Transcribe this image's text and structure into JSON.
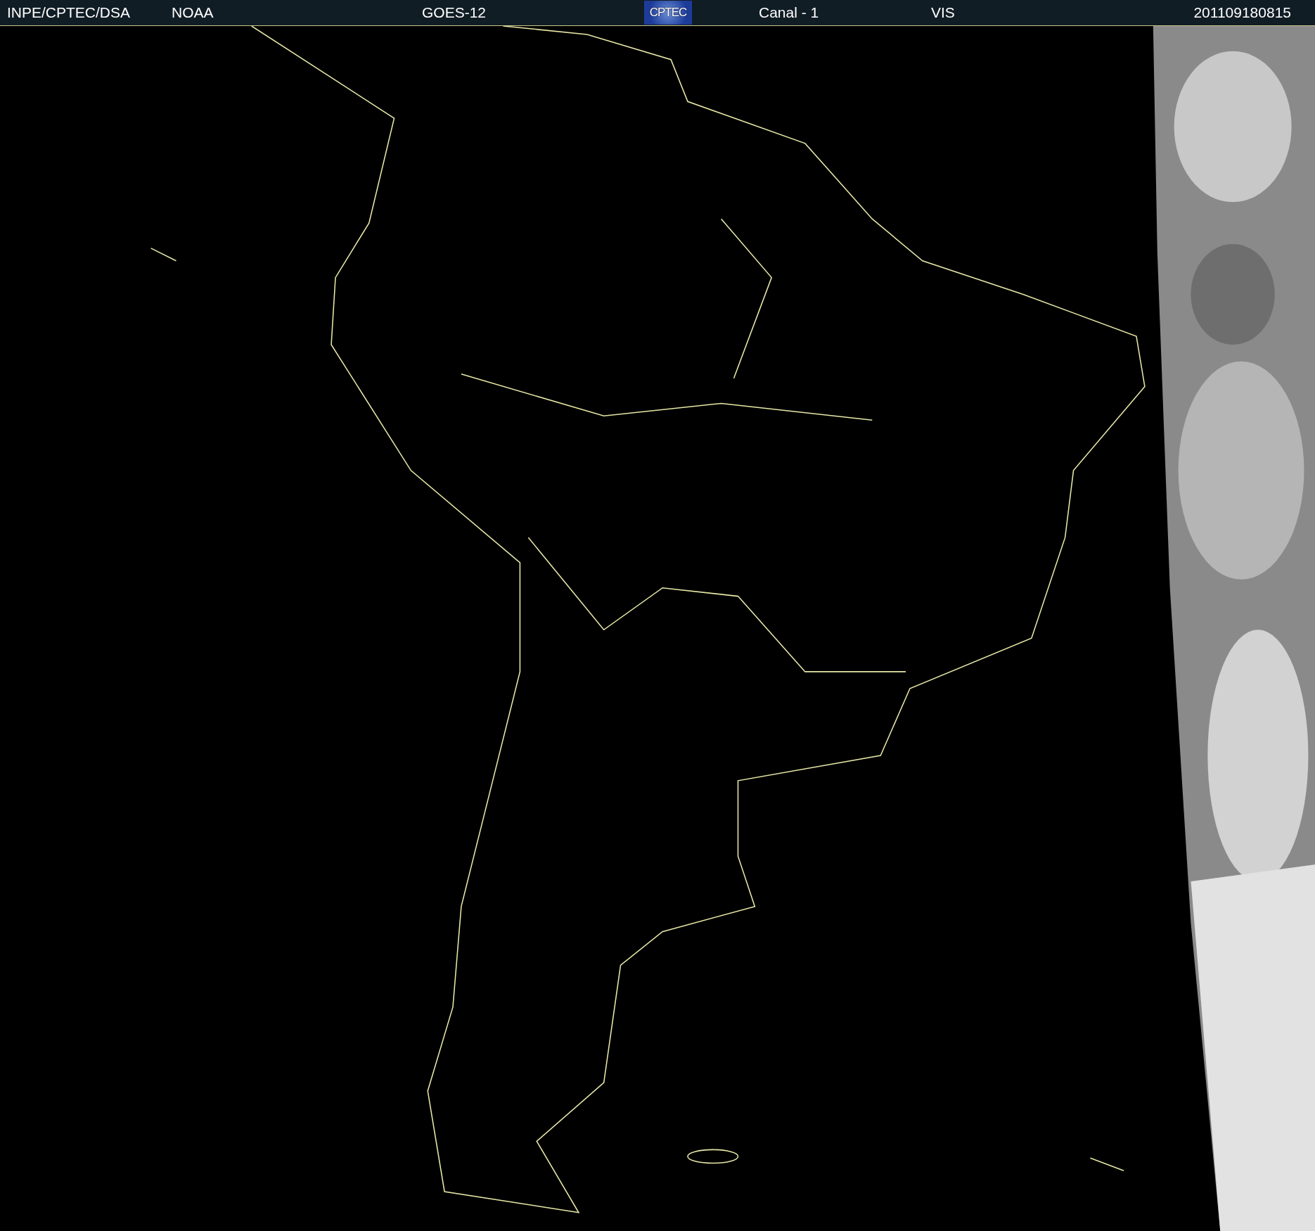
{
  "header": {
    "source": "INPE/CPTEC/DSA",
    "agency": "NOAA",
    "satellite": "GOES-12",
    "logo": "CPTEC",
    "channel": "Canal - 1",
    "band": "VIS",
    "timestamp": "201109180815"
  }
}
